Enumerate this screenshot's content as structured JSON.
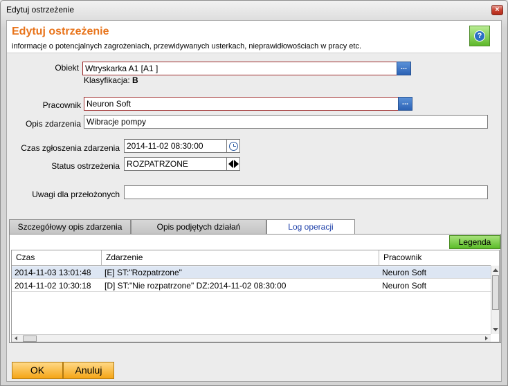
{
  "window": {
    "title": "Edytuj ostrzeżenie",
    "close_symbol": "×"
  },
  "header": {
    "title": "Edytuj ostrzeżenie",
    "subtitle": "informacje o potencjalnych zagrożeniach, przewidywanych usterkach, nieprawidłowościach w pracy etc.",
    "help_symbol": "?"
  },
  "form": {
    "obiekt": {
      "label": "Obiekt",
      "value": "Wtryskarka A1 [A1 ]",
      "button": "..."
    },
    "klasyfikacja": {
      "label": "Klasyfikacja:",
      "value": "B"
    },
    "pracownik": {
      "label": "Pracownik",
      "value": "Neuron Soft",
      "button": "..."
    },
    "opis": {
      "label": "Opis zdarzenia",
      "value": "Wibracje pompy"
    },
    "czas": {
      "label": "Czas zgłoszenia zdarzenia",
      "value": "2014-11-02 08:30:00"
    },
    "status": {
      "label": "Status ostrzeżenia",
      "value": "ROZPATRZONE"
    },
    "uwagi": {
      "label": "Uwagi dla przełożonych",
      "value": ""
    }
  },
  "tabs": [
    {
      "label": "Szczegółowy opis zdarzenia"
    },
    {
      "label": "Opis podjętych działań"
    },
    {
      "label": "Log operacji"
    }
  ],
  "log": {
    "legend_button": "Legenda",
    "columns": [
      "Czas",
      "Zdarzenie",
      "Pracownik"
    ],
    "rows": [
      {
        "czas": "2014-11-03  13:01:48",
        "zdarzenie": "[E]  ST:\"Rozpatrzone\"",
        "pracownik": "Neuron Soft"
      },
      {
        "czas": "2014-11-02  10:30:18",
        "zdarzenie": "[D]  ST:\"Nie rozpatrzone\"  DZ:2014-11-02 08:30:00",
        "pracownik": "Neuron Soft"
      }
    ]
  },
  "actions": {
    "ok": "OK",
    "cancel": "Anuluj"
  },
  "colors": {
    "accent": "#e8741b",
    "button_orange": "#f5a516",
    "button_green": "#5bbd28"
  }
}
